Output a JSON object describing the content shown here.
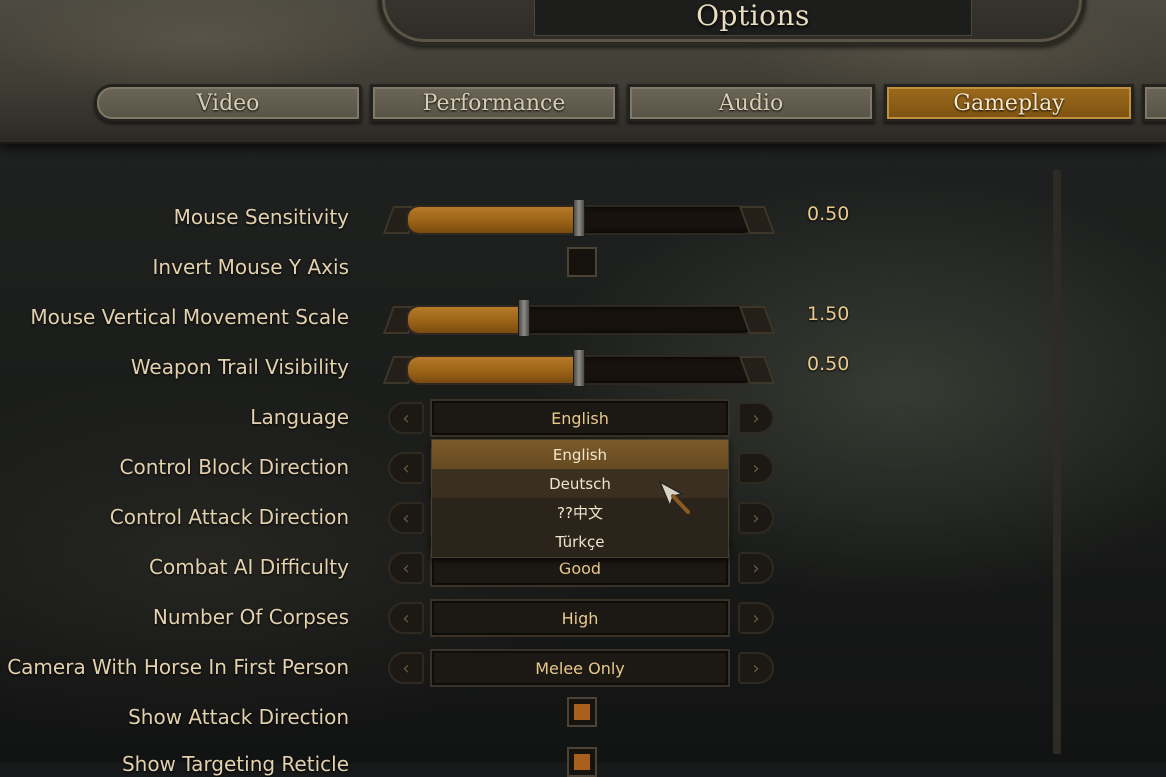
{
  "window": {
    "title": "Options"
  },
  "tabs": [
    {
      "label": "Video",
      "active": false
    },
    {
      "label": "Performance",
      "active": false
    },
    {
      "label": "Audio",
      "active": false
    },
    {
      "label": "Gameplay",
      "active": true
    }
  ],
  "settings": {
    "mouse_sensitivity": {
      "label": "Mouse Sensitivity",
      "value": "0.50",
      "fill_fraction": 0.5
    },
    "invert_mouse_y": {
      "label": "Invert Mouse Y Axis",
      "checked": false
    },
    "mouse_vertical_scale": {
      "label": "Mouse Vertical Movement Scale",
      "value": "1.50",
      "fill_fraction": 0.34
    },
    "weapon_trail": {
      "label": "Weapon Trail Visibility",
      "value": "0.50",
      "fill_fraction": 0.5
    },
    "language": {
      "label": "Language",
      "value": "English"
    },
    "control_block": {
      "label": "Control Block Direction",
      "value": ""
    },
    "control_attack": {
      "label": "Control Attack Direction",
      "value": ""
    },
    "combat_ai": {
      "label": "Combat AI Difficulty",
      "value": "Good"
    },
    "corpses": {
      "label": "Number Of Corpses",
      "value": "High"
    },
    "turn_camera": {
      "label": "Turn Camera With Horse In First Person",
      "value": "Melee Only"
    },
    "show_attack": {
      "label": "Show Attack Direction",
      "checked": true
    },
    "show_targeting": {
      "label": "Show Targeting Reticle",
      "checked": true
    }
  },
  "language_dropdown": {
    "options": [
      "English",
      "Deutsch",
      "??中文",
      "Türkçe"
    ],
    "selected": "English",
    "hovered": "Deutsch"
  },
  "colors": {
    "accent": "#9c6a1c",
    "value_text": "#e9c98d",
    "label_text": "#e3d1ad"
  }
}
